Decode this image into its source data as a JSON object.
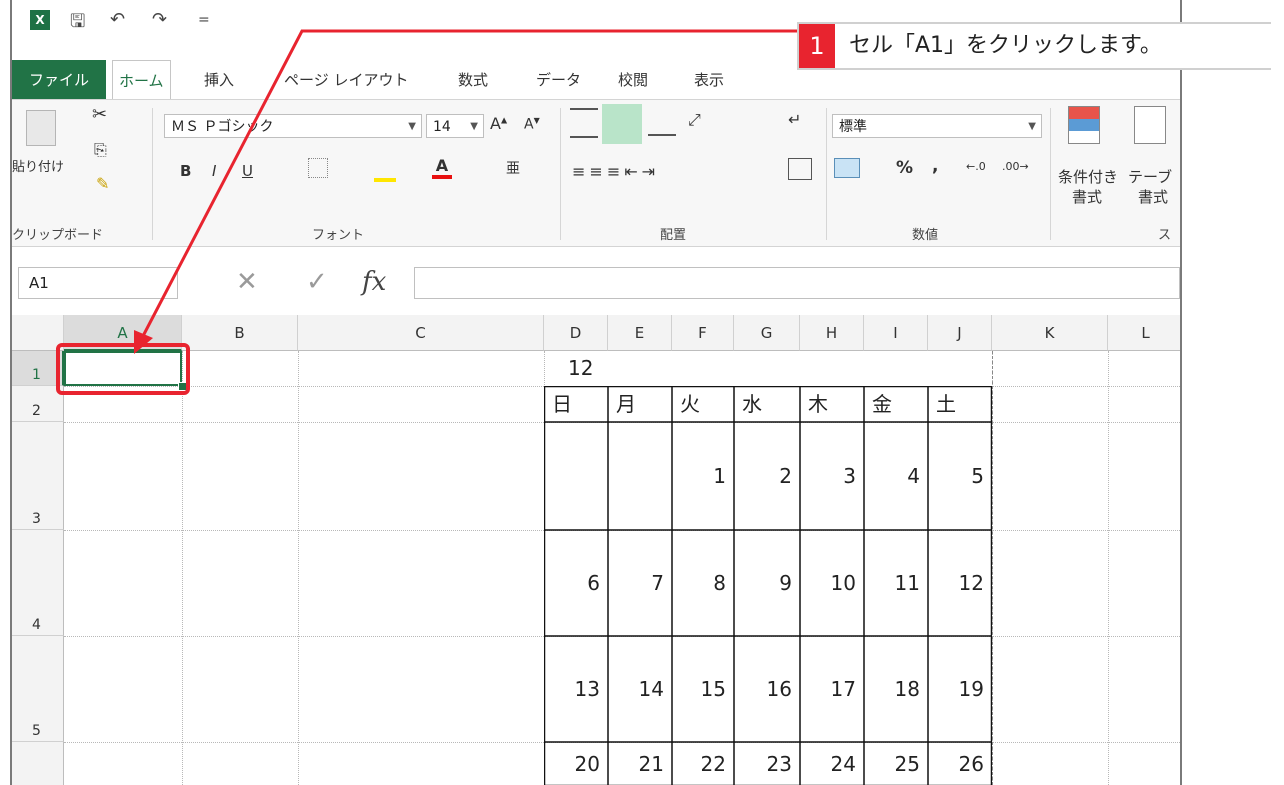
{
  "quick_access": {
    "excel": "X",
    "save": "🖫",
    "undo": "↶",
    "redo": "↷",
    "customize": "="
  },
  "tabs": [
    {
      "label": "ファイル"
    },
    {
      "label": "ホーム"
    },
    {
      "label": "挿入"
    },
    {
      "label": "ページ レイアウト"
    },
    {
      "label": "数式"
    },
    {
      "label": "データ"
    },
    {
      "label": "校閲"
    },
    {
      "label": "表示"
    }
  ],
  "ribbon": {
    "paste_label": "貼り付け",
    "font_name": "ＭＳ Ｐゴシック",
    "font_size": "14",
    "bold": "B",
    "italic": "I",
    "underline": "U",
    "number_format": "標準",
    "percent": "%",
    "comma": ",",
    "cond_format_line1": "条件付き",
    "cond_format_line2": "書式",
    "table_format_line1": "テーブ",
    "table_format_line2": "書式",
    "groups": {
      "clipboard": "クリップボード",
      "font": "フォント",
      "alignment": "配置",
      "number": "数値",
      "styles": "ス"
    }
  },
  "formula_bar": {
    "name_box": "A1",
    "fx": "fx",
    "cancel": "✕",
    "enter": "✓"
  },
  "columns": [
    "A",
    "B",
    "C",
    "D",
    "E",
    "F",
    "G",
    "H",
    "I",
    "J",
    "K",
    "L"
  ],
  "rows": [
    "1",
    "2",
    "3",
    "4",
    "5"
  ],
  "calendar": {
    "month": "12",
    "weekdays": [
      "日",
      "月",
      "火",
      "水",
      "木",
      "金",
      "土"
    ],
    "weeks": [
      [
        "",
        "",
        "1",
        "2",
        "3",
        "4",
        "5"
      ],
      [
        "6",
        "7",
        "8",
        "9",
        "10",
        "11",
        "12"
      ],
      [
        "13",
        "14",
        "15",
        "16",
        "17",
        "18",
        "19"
      ],
      [
        "20",
        "21",
        "22",
        "23",
        "24",
        "25",
        "26"
      ]
    ]
  },
  "callout": {
    "number": "1",
    "text": "セル「A1」をクリックします。"
  },
  "colors": {
    "excel_green": "#217346",
    "highlight_red": "#e8242f"
  }
}
